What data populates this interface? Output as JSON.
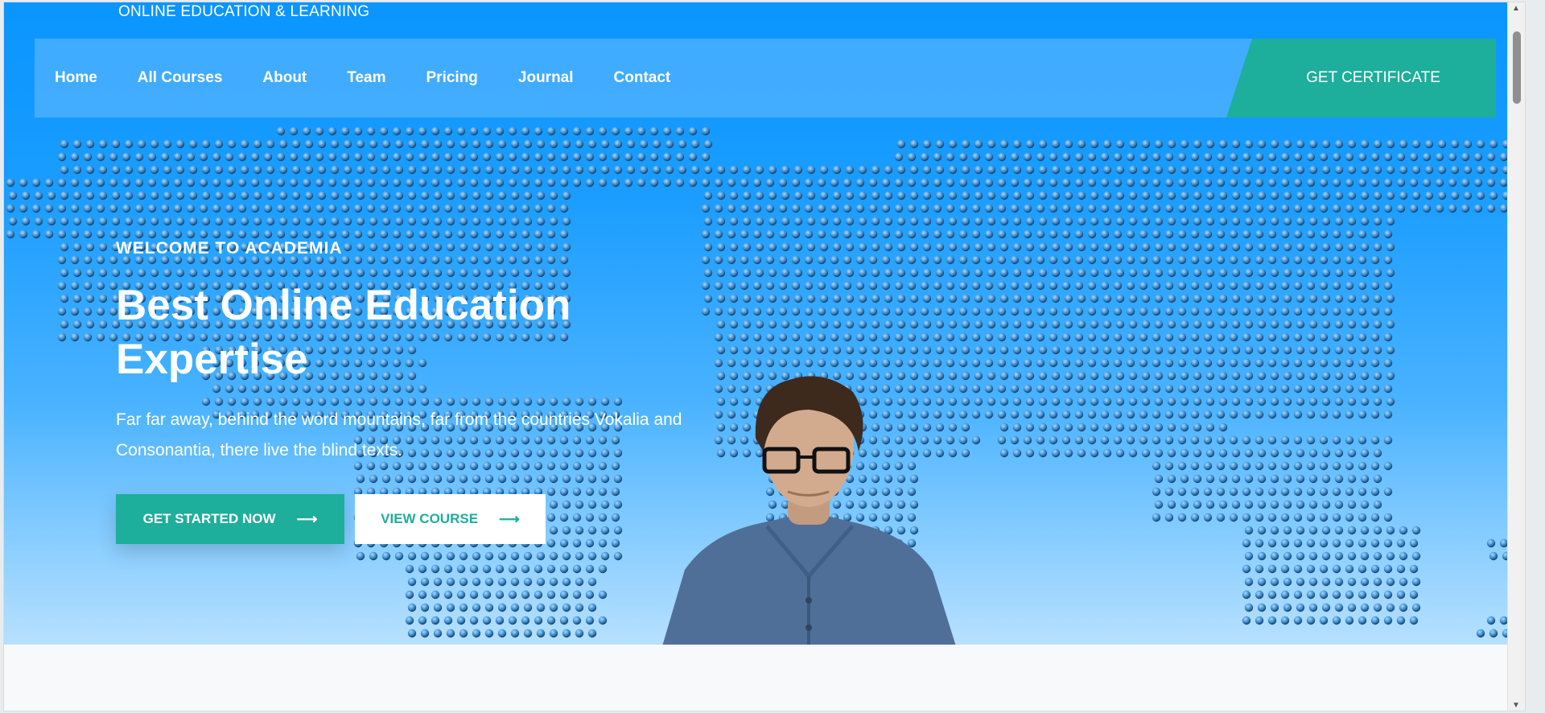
{
  "header": {
    "tagline": "ONLINE EDUCATION & LEARNING"
  },
  "nav": {
    "items": [
      {
        "label": "Home",
        "name": "nav-home"
      },
      {
        "label": "All Courses",
        "name": "nav-all-courses"
      },
      {
        "label": "About",
        "name": "nav-about"
      },
      {
        "label": "Team",
        "name": "nav-team"
      },
      {
        "label": "Pricing",
        "name": "nav-pricing"
      },
      {
        "label": "Journal",
        "name": "nav-journal"
      },
      {
        "label": "Contact",
        "name": "nav-contact"
      }
    ],
    "cta_label": "GET CERTIFICATE"
  },
  "hero": {
    "kicker": "WELCOME TO ACADEMIA",
    "headline_line1": "Best Online Education",
    "headline_line2": "Expertise",
    "description": "Far far away, behind the word mountains, far from the countries Vokalia and Consonantia, there live the blind texts.",
    "primary_button": "GET STARTED NOW",
    "secondary_button": "VIEW COURSE",
    "arrow_icon": "long-arrow-right-icon",
    "background_image": "dotted-world-map",
    "person_image": "student-with-glasses"
  },
  "colors": {
    "brand_blue": "#0a95ff",
    "accent_teal": "#1eae9c",
    "white": "#ffffff"
  },
  "scroll": {
    "up_icon": "▲",
    "down_icon": "▼"
  }
}
